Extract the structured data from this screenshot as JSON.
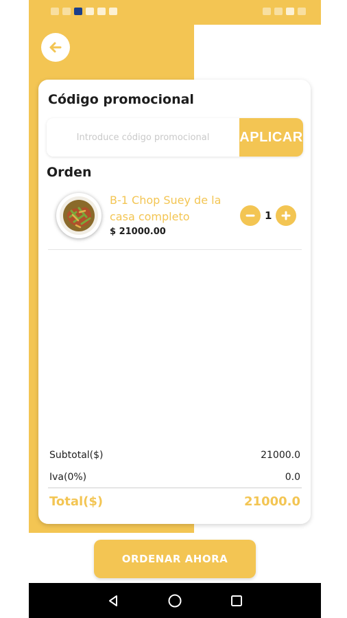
{
  "colors": {
    "accent": "#f3c553",
    "text": "#1d1d1d",
    "white": "#ffffff",
    "nav_bar": "#000000"
  },
  "status_bar": {
    "left_icons": [
      "signal-icon",
      "wifi-icon",
      "notification-icon",
      "whatsapp-icon",
      "mail-icon",
      "gallery-icon"
    ],
    "right_icons": [
      "alarm-icon",
      "network-icon",
      "battery-icon",
      "time"
    ]
  },
  "header": {
    "back_icon": "arrow-left-icon"
  },
  "promo": {
    "title": "Código promocional",
    "placeholder": "Introduce código promocional",
    "value": "",
    "apply_label": "APLICAR"
  },
  "order": {
    "title": "Orden",
    "items": [
      {
        "name": "B-1 Chop Suey de la casa completo",
        "price": "$ 21000.00",
        "quantity": "1",
        "image_icon": "food-plate-icon"
      }
    ]
  },
  "summary": {
    "subtotal_label": "Subtotal($)",
    "subtotal_value": "21000.0",
    "iva_label": "Iva(0%)",
    "iva_value": "0.0",
    "total_label": "Total($)",
    "total_value": "21000.0"
  },
  "order_button": {
    "label": "ORDENAR AHORA"
  },
  "nav_bar": {
    "buttons": [
      "back-triangle-icon",
      "home-circle-icon",
      "recents-square-icon"
    ]
  }
}
